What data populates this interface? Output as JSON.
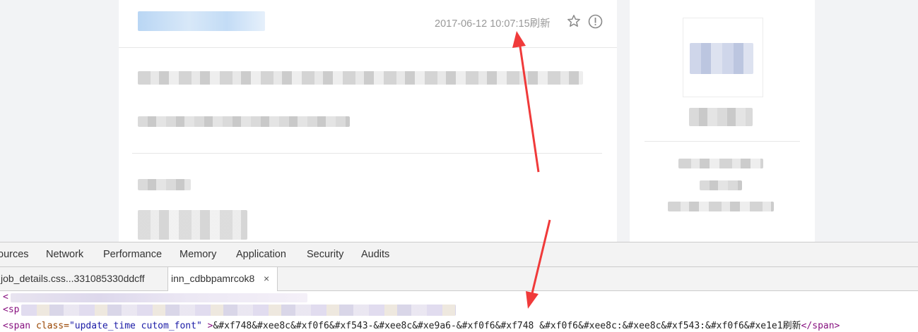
{
  "page": {
    "timestamp": "2017-06-12 10:07:15",
    "refresh_label": "刷新",
    "star_icon": "star-outline-icon",
    "report_icon": "exclamation-circle-icon"
  },
  "devtools": {
    "tabs": [
      "ources",
      "Network",
      "Performance",
      "Memory",
      "Application",
      "Security",
      "Audits"
    ],
    "file_tabs": {
      "first": "job_details.css...331085330ddcff",
      "second": "inn_cdbbpamrcok8",
      "close": "×"
    },
    "code": {
      "line1_prefix": "<",
      "line2_prefix": "<sp",
      "line3": {
        "open": "<span ",
        "attr_class": "class=",
        "attr_value": "\"update_time cutom_font\"",
        "close_open": " >",
        "content": "&#xf748&#xee8c&#xf0f6&#xf543-&#xee8c&#xe9a6-&#xf0f6&#xf748 &#xf0f6&#xee8c:&#xee8c&#xf543:&#xf0f6&#xe1e1刷新",
        "end_tag": "</span>"
      }
    }
  },
  "colors": {
    "arrow": "#f03a3a",
    "tag": "#881280",
    "attr": "#994500",
    "attr_value": "#1a1aa6"
  }
}
